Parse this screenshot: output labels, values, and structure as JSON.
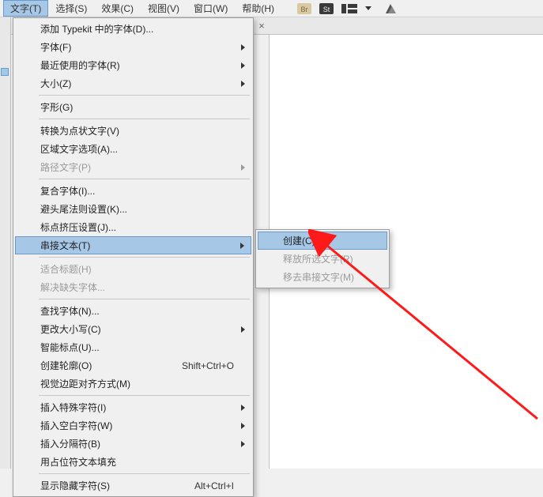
{
  "menubar": {
    "items": [
      {
        "label": "文字(T)"
      },
      {
        "label": "选择(S)"
      },
      {
        "label": "效果(C)"
      },
      {
        "label": "视图(V)"
      },
      {
        "label": "窗口(W)"
      },
      {
        "label": "帮助(H)"
      }
    ]
  },
  "doc": {
    "close_glyph": "×"
  },
  "menu_main": {
    "items": [
      {
        "label": "添加 Typekit 中的字体(D)..."
      },
      {
        "label": "字体(F)",
        "submenu": true
      },
      {
        "label": "最近使用的字体(R)",
        "submenu": true
      },
      {
        "label": "大小(Z)",
        "submenu": true
      },
      {
        "sep": true
      },
      {
        "label": "字形(G)"
      },
      {
        "sep": true
      },
      {
        "label": "转换为点状文字(V)"
      },
      {
        "label": "区域文字选项(A)..."
      },
      {
        "label": "路径文字(P)",
        "submenu": true,
        "disabled": true
      },
      {
        "sep": true
      },
      {
        "label": "复合字体(I)..."
      },
      {
        "label": "避头尾法则设置(K)..."
      },
      {
        "label": "标点挤压设置(J)..."
      },
      {
        "label": "串接文本(T)",
        "submenu": true,
        "highlight": true
      },
      {
        "sep": true
      },
      {
        "label": "适合标题(H)",
        "disabled": true
      },
      {
        "label": "解决缺失字体...",
        "disabled": true
      },
      {
        "sep": true
      },
      {
        "label": "查找字体(N)..."
      },
      {
        "label": "更改大小写(C)",
        "submenu": true
      },
      {
        "label": "智能标点(U)..."
      },
      {
        "label": "创建轮廓(O)",
        "shortcut": "Shift+Ctrl+O"
      },
      {
        "label": "视觉边距对齐方式(M)"
      },
      {
        "sep": true
      },
      {
        "label": "插入特殊字符(I)",
        "submenu": true
      },
      {
        "label": "插入空白字符(W)",
        "submenu": true
      },
      {
        "label": "插入分隔符(B)",
        "submenu": true
      },
      {
        "label": "用占位符文本填充"
      },
      {
        "sep": true
      },
      {
        "label": "显示隐藏字符(S)",
        "shortcut": "Alt+Ctrl+I"
      }
    ]
  },
  "menu_sub": {
    "items": [
      {
        "label": "创建(C)",
        "highlight": true
      },
      {
        "label": "释放所选文字(R)",
        "disabled": true
      },
      {
        "label": "移去串接文字(M)",
        "disabled": true
      }
    ]
  }
}
